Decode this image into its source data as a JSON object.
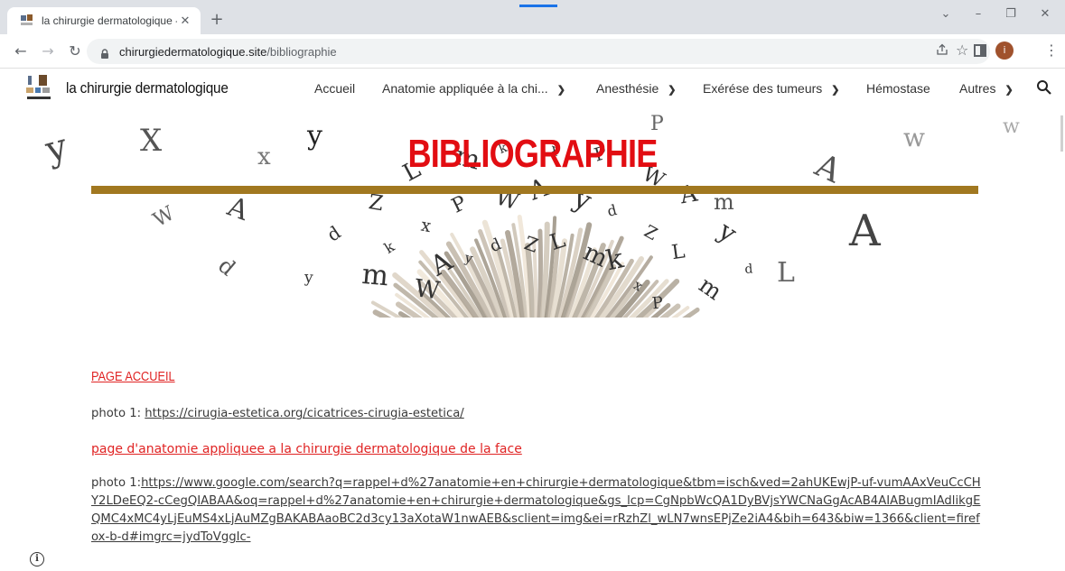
{
  "browser": {
    "tab_title": "la chirurgie dermatologique - Bi",
    "tab_close": "✕",
    "new_tab": "+",
    "url_domain": "chirurgiedermatologique.site",
    "url_path": "/bibliographie",
    "profile_initial": "i",
    "window_controls": [
      "⌄",
      "–",
      "❐",
      "✕"
    ]
  },
  "site": {
    "title": "la chirurgie dermatologique",
    "nav": [
      {
        "label": "Accueil",
        "dropdown": false
      },
      {
        "label": "Anatomie appliquée à la chi...",
        "dropdown": true
      },
      {
        "label": "Anesthésie",
        "dropdown": true
      },
      {
        "label": "Exérése des tumeurs",
        "dropdown": true
      },
      {
        "label": "Hémostase",
        "dropdown": false
      },
      {
        "label": "Autres",
        "dropdown": true
      }
    ]
  },
  "hero": {
    "title": "BIBLIOGRAPHIE"
  },
  "content": {
    "heading_1": "PAGE  ACCUEIL",
    "photo1_label": "photo 1: ",
    "photo1_link": "https://cirugia-estetica.org/cicatrices-cirugia-estetica/",
    "heading_2": "page  d'anatomie appliquee a la chirurgie dermatologique de la face ",
    "photo2_label": "photo 1:",
    "photo2_link": "https://www.google.com/search?q=rappel+d%27anatomie+en+chirurgie+dermatologique&tbm=isch&ved=2ahUKEwjP-uf-vumAAxVeuCcCHY2LDeEQ2-cCegQIABAA&oq=rappel+d%27anatomie+en+chirurgie+dermatologique&gs_lcp=CgNpbWcQA1DyBVjsYWCNaGgAcAB4AIABugmIAdlikgEQMC4xMC4yLjEuMS4xLjAuMZgBAKABAaoBC2d3cy13aXotaW1nwAEB&sclient=img&ei=rRzhZl_wLN7wnsEPjZe2iA4&bih=643&biw=1366&client=firefox-b-d#imgrc=jydToVggIc-"
  },
  "colors": {
    "title_red": "#e20d12",
    "accent_bar": "#a17820",
    "link_red": "#e02424",
    "profile_bg": "#a0522d"
  }
}
